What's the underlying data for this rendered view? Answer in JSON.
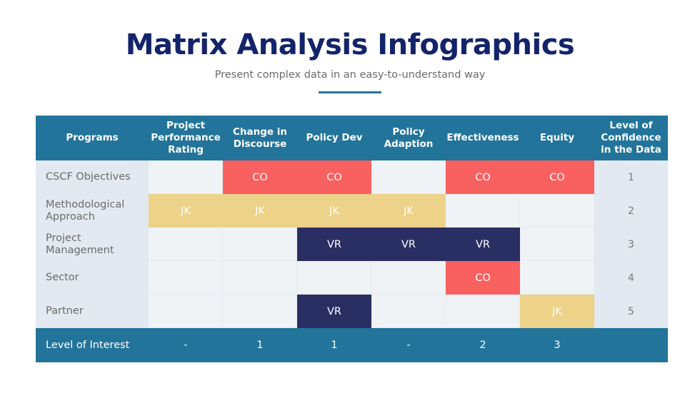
{
  "header": {
    "title": "Matrix Analysis Infographics",
    "subtitle": "Present complex data in an easy-to-understand way"
  },
  "colors": {
    "title": "#13246b",
    "header_bg": "#22749a",
    "CO": "#f96060",
    "JK": "#edd28a",
    "VR": "#2a2f63",
    "empty": "#eff3f6",
    "side": "#e2e9f0"
  },
  "table": {
    "columns": [
      "Programs",
      "Project Performance Rating",
      "Change in Discourse",
      "Policy Dev",
      "Policy Adaption",
      "Effectiveness",
      "Equity",
      "Level of Confidence in the Data"
    ],
    "rows": [
      {
        "program": "CSCF Objectives",
        "cells": [
          "",
          "CO",
          "CO",
          "",
          "CO",
          "CO"
        ],
        "confidence": "1"
      },
      {
        "program": "Methodological Approach",
        "cells": [
          "JK",
          "JK",
          "JK",
          "JK",
          "",
          ""
        ],
        "confidence": "2"
      },
      {
        "program": "Project Management",
        "cells": [
          "",
          "",
          "VR",
          "VR",
          "VR",
          ""
        ],
        "confidence": "3"
      },
      {
        "program": "Sector",
        "cells": [
          "",
          "",
          "",
          "",
          "CO",
          ""
        ],
        "confidence": "4"
      },
      {
        "program": "Partner",
        "cells": [
          "",
          "",
          "VR",
          "",
          "",
          "JK"
        ],
        "confidence": "5"
      }
    ],
    "footer": {
      "label": "Level of Interest",
      "values": [
        "-",
        "1",
        "1",
        "-",
        "2",
        "3"
      ],
      "confidence": ""
    }
  }
}
